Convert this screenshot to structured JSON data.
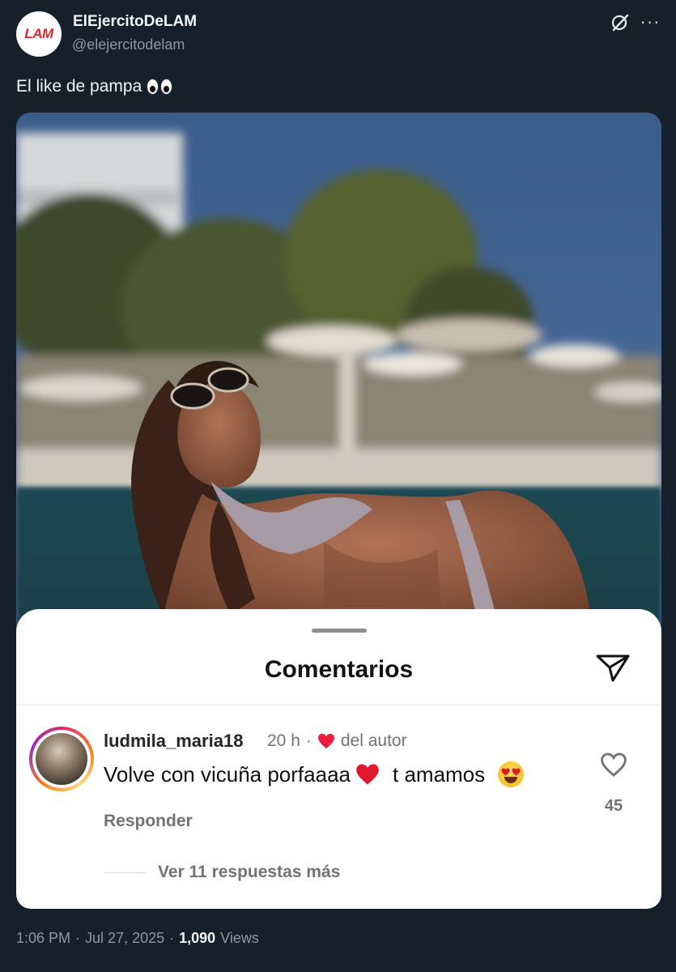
{
  "account": {
    "display_name": "ElEjercitoDeLAM",
    "handle": "@elejercitodelam",
    "avatar_logo": "LAM"
  },
  "tweet": {
    "text": "El like de pampa",
    "text_emoji": "eyes-emoji",
    "time": "1:06 PM",
    "date": "Jul 27, 2025",
    "views_count": "1,090",
    "views_label": "Views",
    "separator": "·"
  },
  "comments_sheet": {
    "title": "Comentarios",
    "comment": {
      "username": "ludmila_maria18",
      "time_ago": "20 h",
      "separator": "·",
      "author_like_label": "del autor",
      "text_part1": "Volve con vicuña porfaaaa",
      "text_part2": "t amamos",
      "reply_label": "Responder",
      "like_count": "45"
    },
    "view_more_replies": "Ver 11 respuestas más"
  },
  "colors": {
    "background": "#15202b",
    "accent_red": "#e3262b",
    "muted_text": "#8b98a5",
    "sheet_bg": "#ffffff",
    "sheet_muted": "#737373"
  }
}
